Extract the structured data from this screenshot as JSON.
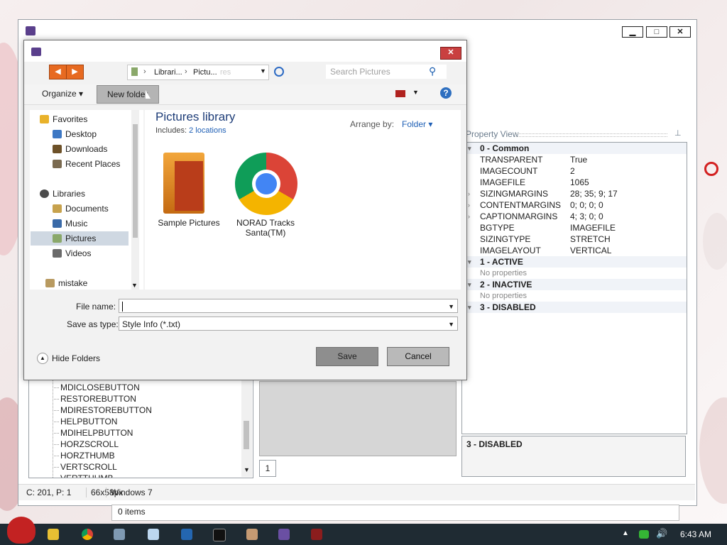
{
  "app_window": {
    "minimize_label": "▁",
    "maximize_label": "□",
    "close_label": "✕"
  },
  "property_view": {
    "title": "Property View",
    "pin_glyph": "📌",
    "rows": [
      {
        "kind": "category",
        "key": "0 - Common",
        "value": ""
      },
      {
        "kind": "prop",
        "key": "TRANSPARENT",
        "value": "True",
        "expandable": false
      },
      {
        "kind": "prop",
        "key": "IMAGECOUNT",
        "value": "2",
        "expandable": false
      },
      {
        "kind": "prop",
        "key": "IMAGEFILE",
        "value": "1065",
        "expandable": false
      },
      {
        "kind": "prop",
        "key": "SIZINGMARGINS",
        "value": "28; 35; 9; 17",
        "expandable": true
      },
      {
        "kind": "prop",
        "key": "CONTENTMARGINS",
        "value": "0; 0; 0; 0",
        "expandable": true
      },
      {
        "kind": "prop",
        "key": "CAPTIONMARGINS",
        "value": "4; 3; 0; 0",
        "expandable": true
      },
      {
        "kind": "prop",
        "key": "BGTYPE",
        "value": "IMAGEFILE",
        "expandable": false
      },
      {
        "kind": "prop",
        "key": "SIZINGTYPE",
        "value": "STRETCH",
        "expandable": false
      },
      {
        "kind": "prop",
        "key": "IMAGELAYOUT",
        "value": "VERTICAL",
        "expandable": false
      },
      {
        "kind": "category",
        "key": "1 - ACTIVE",
        "value": ""
      },
      {
        "kind": "none",
        "key": "No properties",
        "value": ""
      },
      {
        "kind": "category",
        "key": "2 - INACTIVE",
        "value": ""
      },
      {
        "kind": "none",
        "key": "No properties",
        "value": ""
      },
      {
        "kind": "category",
        "key": "3 - DISABLED",
        "value": ""
      }
    ],
    "description": "3 - DISABLED"
  },
  "tree": {
    "items": [
      "MDICLOSEBUTTON",
      "RESTOREBUTTON",
      "MDIRESTOREBUTTON",
      "HELPBUTTON",
      "MDIHELPBUTTON",
      "HORZSCROLL",
      "HORZTHUMB",
      "VERTSCROLL",
      "VERTTHUMB"
    ]
  },
  "preview": {
    "image_index": "1"
  },
  "status_bar": {
    "cursor": "C: 201, P: 1",
    "size": "66x58px",
    "os": "Windows 7"
  },
  "explorer_status": "0 items",
  "dialog": {
    "breadcrumb": [
      "Librari...",
      "Pictu..."
    ],
    "breadcrumb_ghost": "res",
    "search_placeholder": "Search Pictures",
    "organize_label": "Organize",
    "new_folder_label": "New folder",
    "library_title": "Pictures library",
    "includes_label": "Includes:",
    "includes_link": "2 locations",
    "arrange_label": "Arrange by:",
    "arrange_value": "Folder",
    "nav": {
      "favorites": "Favorites",
      "desktop": "Desktop",
      "downloads": "Downloads",
      "recent": "Recent Places",
      "libraries": "Libraries",
      "documents": "Documents",
      "music": "Music",
      "pictures": "Pictures",
      "videos": "Videos",
      "user": "mistake"
    },
    "files": [
      {
        "name": "Sample Pictures"
      },
      {
        "name": "NORAD Tracks Santa(TM)"
      }
    ],
    "file_name_label": "File name:",
    "file_name_value": "",
    "save_type_label": "Save as type:",
    "save_type_value": "Style Info (*.txt)",
    "hide_folders_label": "Hide Folders",
    "save_label": "Save",
    "cancel_label": "Cancel"
  },
  "taskbar": {
    "clock": "6:43 AM"
  },
  "colors": {
    "accent_blue": "#1e3d78",
    "nav_selection": "#cfd8e2",
    "close_red": "#c94040",
    "taskbar": "#1f2b33"
  }
}
